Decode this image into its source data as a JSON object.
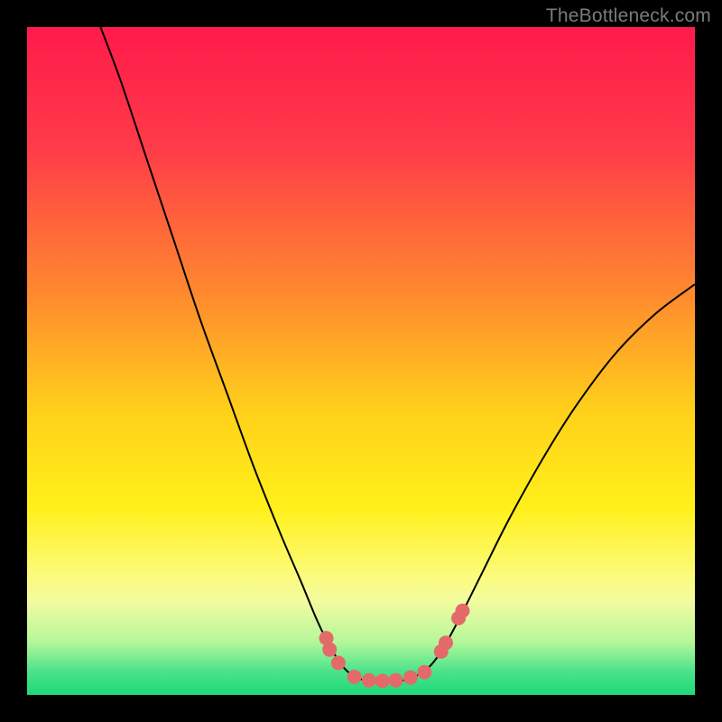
{
  "watermark": "TheBottleneck.com",
  "chart_data": {
    "type": "line",
    "title": "",
    "xlabel": "",
    "ylabel": "",
    "xlim": [
      0,
      100
    ],
    "ylim": [
      0,
      100
    ],
    "background": {
      "type": "vertical-gradient",
      "stops": [
        {
          "offset": 0.0,
          "color": "#ff1a4b"
        },
        {
          "offset": 0.18,
          "color": "#ff3b49"
        },
        {
          "offset": 0.4,
          "color": "#ff8a2e"
        },
        {
          "offset": 0.58,
          "color": "#ffd21a"
        },
        {
          "offset": 0.72,
          "color": "#fff01a"
        },
        {
          "offset": 0.82,
          "color": "#fcfb7a"
        },
        {
          "offset": 0.86,
          "color": "#f3fba0"
        },
        {
          "offset": 0.92,
          "color": "#b6f79a"
        },
        {
          "offset": 0.965,
          "color": "#4be38a"
        },
        {
          "offset": 1.0,
          "color": "#1fd87a"
        }
      ]
    },
    "series": [
      {
        "name": "bottleneck-curve",
        "stroke": "#000000",
        "stroke_width": 2,
        "points": [
          {
            "x": 11.0,
            "y": 100.0
          },
          {
            "x": 14.0,
            "y": 92.0
          },
          {
            "x": 18.0,
            "y": 80.0
          },
          {
            "x": 22.0,
            "y": 68.0
          },
          {
            "x": 26.0,
            "y": 56.0
          },
          {
            "x": 30.0,
            "y": 45.0
          },
          {
            "x": 34.0,
            "y": 34.0
          },
          {
            "x": 38.0,
            "y": 24.0
          },
          {
            "x": 41.0,
            "y": 17.0
          },
          {
            "x": 43.5,
            "y": 11.0
          },
          {
            "x": 45.5,
            "y": 7.0
          },
          {
            "x": 47.5,
            "y": 4.0
          },
          {
            "x": 49.5,
            "y": 2.5
          },
          {
            "x": 52.0,
            "y": 2.0
          },
          {
            "x": 55.0,
            "y": 2.0
          },
          {
            "x": 57.5,
            "y": 2.5
          },
          {
            "x": 60.0,
            "y": 4.0
          },
          {
            "x": 62.0,
            "y": 6.5
          },
          {
            "x": 64.5,
            "y": 11.0
          },
          {
            "x": 68.0,
            "y": 18.0
          },
          {
            "x": 72.0,
            "y": 26.0
          },
          {
            "x": 77.0,
            "y": 35.0
          },
          {
            "x": 82.0,
            "y": 43.0
          },
          {
            "x": 88.0,
            "y": 51.0
          },
          {
            "x": 94.0,
            "y": 57.0
          },
          {
            "x": 100.0,
            "y": 61.5
          }
        ]
      }
    ],
    "markers": {
      "color": "#e46a6a",
      "radius": 8,
      "points": [
        {
          "x": 44.8,
          "y": 8.5
        },
        {
          "x": 45.3,
          "y": 6.8
        },
        {
          "x": 46.6,
          "y": 4.8
        },
        {
          "x": 49.0,
          "y": 2.7
        },
        {
          "x": 51.2,
          "y": 2.2
        },
        {
          "x": 53.2,
          "y": 2.1
        },
        {
          "x": 55.2,
          "y": 2.2
        },
        {
          "x": 57.4,
          "y": 2.6
        },
        {
          "x": 59.5,
          "y": 3.4
        },
        {
          "x": 62.0,
          "y": 6.5
        },
        {
          "x": 62.7,
          "y": 7.8
        },
        {
          "x": 64.6,
          "y": 11.5
        },
        {
          "x": 65.2,
          "y": 12.6
        }
      ]
    }
  }
}
